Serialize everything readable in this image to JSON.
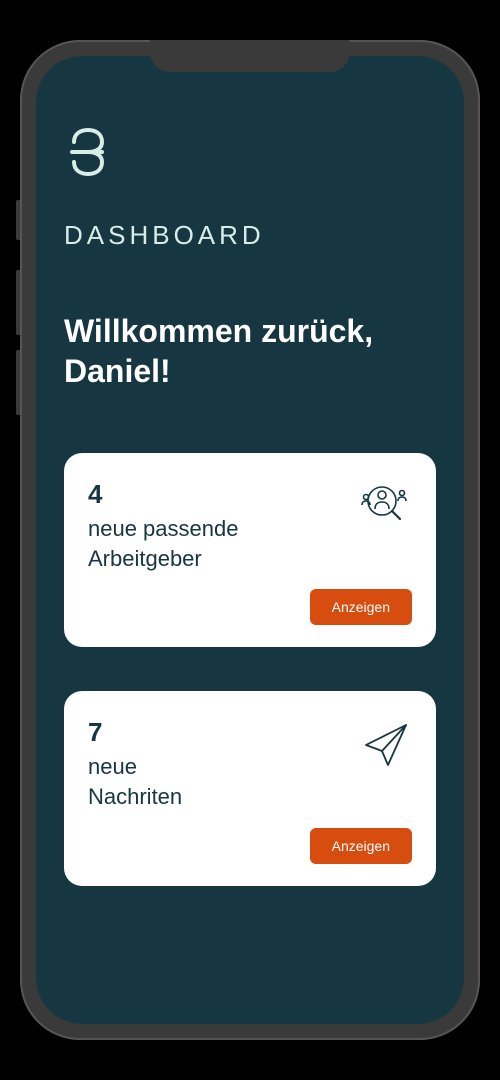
{
  "header": {
    "page_title": "DASHBOARD",
    "welcome_line1": "Willkommen zurück,",
    "welcome_line2": "Daniel!"
  },
  "cards": [
    {
      "count": "4",
      "label_line1": "neue passende",
      "label_line2": "Arbeitgeber",
      "icon": "employer-search-icon",
      "button_label": "Anzeigen"
    },
    {
      "count": "7",
      "label_line1": "neue",
      "label_line2": "Nachriten",
      "icon": "paper-plane-icon",
      "button_label": "Anzeigen"
    }
  ],
  "colors": {
    "screen_bg": "#163641",
    "card_bg": "#ffffff",
    "accent": "#d64d0f",
    "text_light": "#d9ede6",
    "text_dark": "#163641"
  }
}
